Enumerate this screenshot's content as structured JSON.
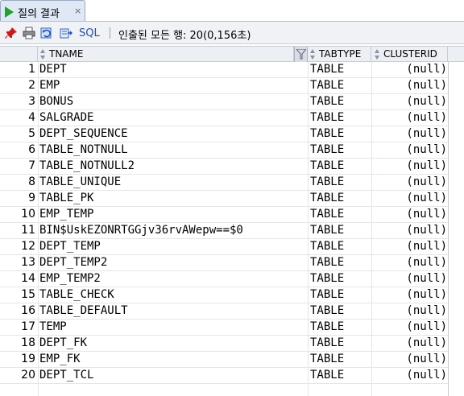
{
  "tab": {
    "label": "질의 결과",
    "close": "×"
  },
  "toolbar": {
    "sql_label": "SQL",
    "status": "인출된 모든 행: 20(0,156초)"
  },
  "columns": [
    {
      "name": "TNAME"
    },
    {
      "name": "TABTYPE"
    },
    {
      "name": "CLUSTERID"
    }
  ],
  "rows": [
    [
      "1",
      "DEPT",
      "TABLE",
      "(null)"
    ],
    [
      "2",
      "EMP",
      "TABLE",
      "(null)"
    ],
    [
      "3",
      "BONUS",
      "TABLE",
      "(null)"
    ],
    [
      "4",
      "SALGRADE",
      "TABLE",
      "(null)"
    ],
    [
      "5",
      "DEPT_SEQUENCE",
      "TABLE",
      "(null)"
    ],
    [
      "6",
      "TABLE_NOTNULL",
      "TABLE",
      "(null)"
    ],
    [
      "7",
      "TABLE_NOTNULL2",
      "TABLE",
      "(null)"
    ],
    [
      "8",
      "TABLE_UNIQUE",
      "TABLE",
      "(null)"
    ],
    [
      "9",
      "TABLE_PK",
      "TABLE",
      "(null)"
    ],
    [
      "10",
      "EMP_TEMP",
      "TABLE",
      "(null)"
    ],
    [
      "11",
      "BIN$UskEZONRTGGjv36rvAWepw==$0",
      "TABLE",
      "(null)"
    ],
    [
      "12",
      "DEPT_TEMP",
      "TABLE",
      "(null)"
    ],
    [
      "13",
      "DEPT_TEMP2",
      "TABLE",
      "(null)"
    ],
    [
      "14",
      "EMP_TEMP2",
      "TABLE",
      "(null)"
    ],
    [
      "15",
      "TABLE_CHECK",
      "TABLE",
      "(null)"
    ],
    [
      "16",
      "TABLE_DEFAULT",
      "TABLE",
      "(null)"
    ],
    [
      "17",
      "TEMP",
      "TABLE",
      "(null)"
    ],
    [
      "18",
      "DEPT_FK",
      "TABLE",
      "(null)"
    ],
    [
      "19",
      "EMP_FK",
      "TABLE",
      "(null)"
    ],
    [
      "20",
      "DEPT_TCL",
      "TABLE",
      "(null)"
    ]
  ]
}
